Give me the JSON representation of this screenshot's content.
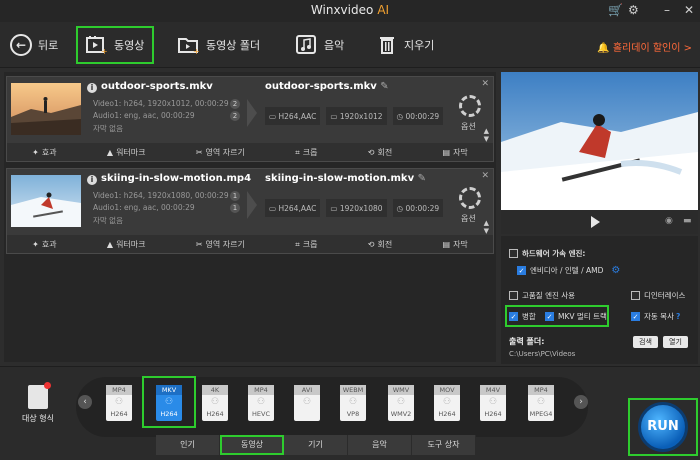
{
  "app": {
    "title": "Winxvideo",
    "title_ai": "AI"
  },
  "toolbar": {
    "back_label": "뒤로",
    "video_label": "동영상",
    "folder_label": "동영상 폴더",
    "music_label": "음악",
    "clear_label": "지우기",
    "promo": "홀리데이 할인이 >"
  },
  "files": [
    {
      "name": "outdoor-sports.mkv",
      "video": "Video1: h264, 1920x1012, 00:00:29",
      "audio": "Audio1: eng, aac, 00:00:29",
      "subtitle": "자막 없음",
      "video_count": "2",
      "audio_count": "2",
      "out_name": "outdoor-sports.mkv",
      "out_codec": "H264,AAC",
      "out_res": "1920x1012",
      "out_dur": "00:00:29",
      "options": "옵션"
    },
    {
      "name": "skiing-in-slow-motion.mp4",
      "video": "Video1: h264, 1920x1080, 00:00:29",
      "audio": "Audio1: eng, aac, 00:00:29",
      "subtitle": "자막 없음",
      "video_count": "1",
      "audio_count": "1",
      "out_name": "skiing-in-slow-motion.mkv",
      "out_codec": "H264,AAC",
      "out_res": "1920x1080",
      "out_dur": "00:00:29",
      "options": "옵션"
    }
  ],
  "edit_tools": [
    "효과",
    "워터마크",
    "영역 자르기",
    "크롭",
    "회전",
    "자막"
  ],
  "settings": {
    "hw_accel": "하드웨어 가속 엔진:",
    "hw_vendor": "엔비디아 / 인텔 / AMD",
    "hq_engine": "고품질 엔진 사용",
    "deinterlace": "디인터레이스",
    "merge": "병합",
    "mkv_multitrack": "MKV 멀티 트랙",
    "auto_copy": "자동 복사",
    "output_folder_label": "출력 폴더:",
    "output_folder_path": "C:\\Users\\PC\\Videos",
    "browse": "검색",
    "open": "열기"
  },
  "bottom": {
    "target_label": "대상 형식",
    "formats": [
      {
        "top": "MP4",
        "bottom": "H264"
      },
      {
        "top": "MKV",
        "bottom": "H264"
      },
      {
        "top": "4K",
        "bottom": "H264"
      },
      {
        "top": "MP4",
        "bottom": "HEVC"
      },
      {
        "top": "AVI",
        "bottom": ""
      },
      {
        "top": "WEBM",
        "bottom": "VP8"
      },
      {
        "top": "WMV",
        "bottom": "WMV2"
      },
      {
        "top": "MOV",
        "bottom": "H264"
      },
      {
        "top": "M4V",
        "bottom": "H264"
      },
      {
        "top": "MP4",
        "bottom": "MPEG4"
      }
    ],
    "tabs": [
      "인기",
      "동영상",
      "기기",
      "음악",
      "도구 상자"
    ],
    "run": "RUN"
  }
}
